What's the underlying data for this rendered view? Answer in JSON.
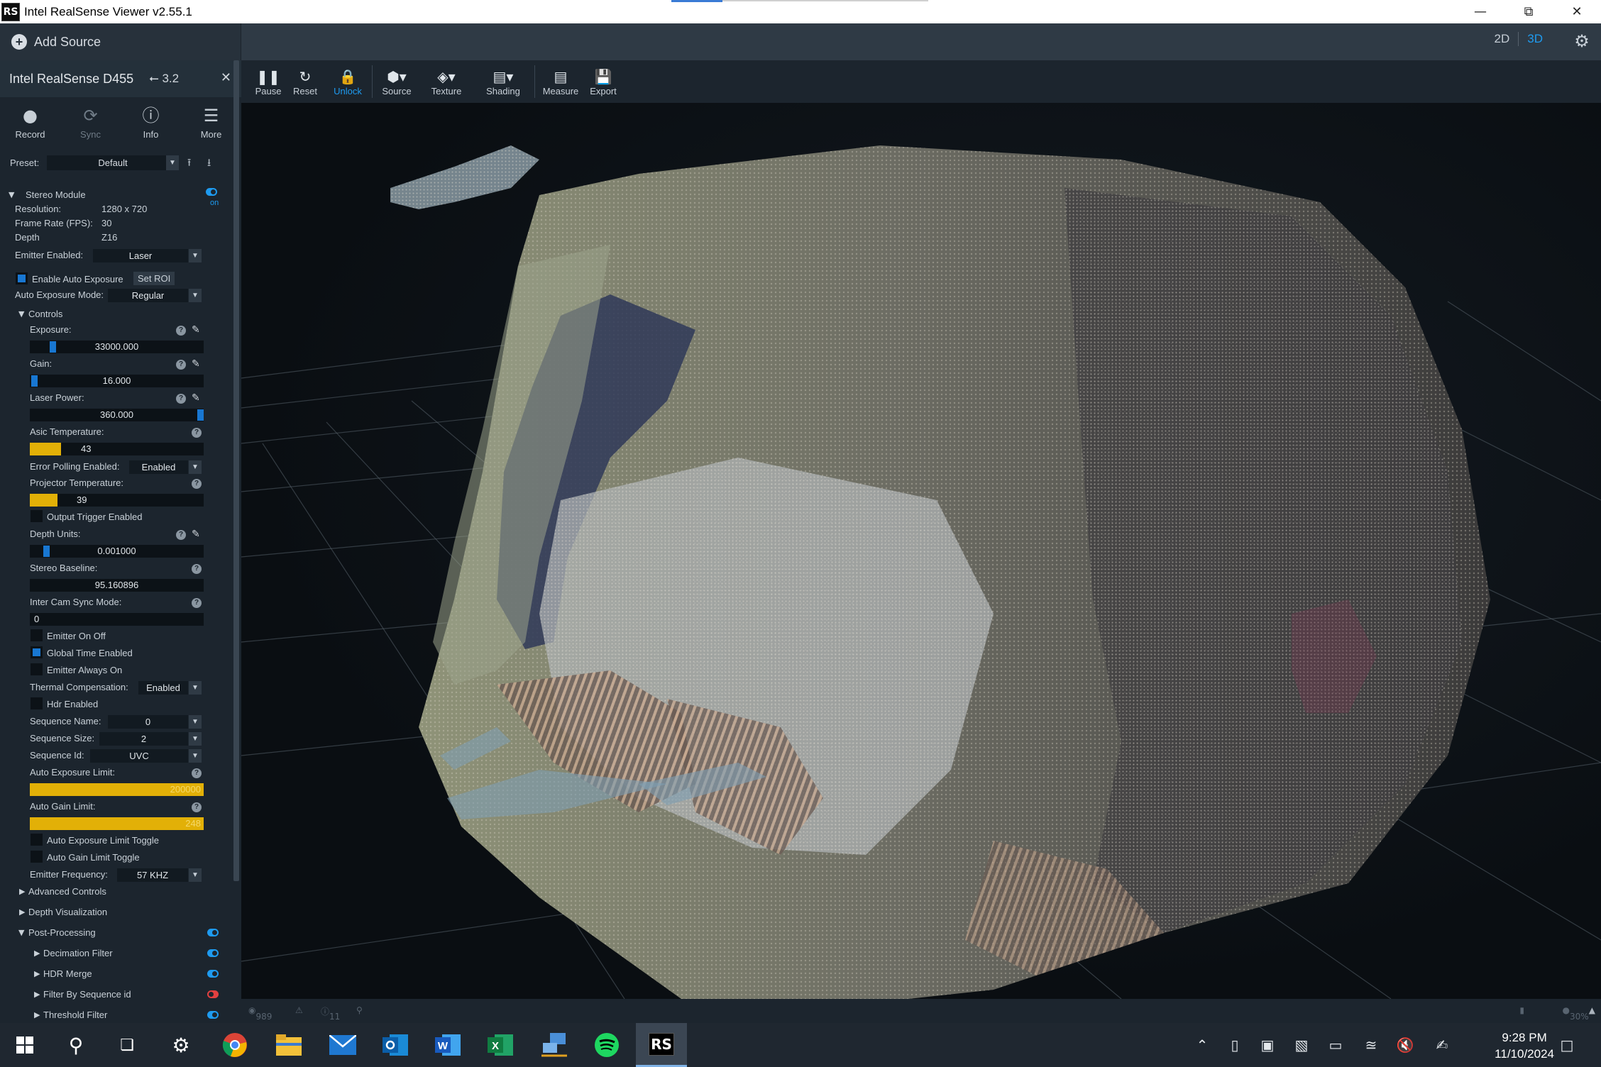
{
  "window": {
    "title": "Intel RealSense Viewer v2.55.1",
    "app_icon": "RS"
  },
  "topbar": {
    "add_source": "Add Source",
    "view_2d": "2D",
    "view_3d": "3D"
  },
  "device": {
    "name": "Intel RealSense D455",
    "usb": "3.2",
    "tools": [
      {
        "label": "Record",
        "icon": "record-icon"
      },
      {
        "label": "Sync",
        "icon": "sync-icon"
      },
      {
        "label": "Info",
        "icon": "info-icon"
      },
      {
        "label": "More",
        "icon": "menu-icon"
      }
    ],
    "preset_label": "Preset:",
    "preset_value": "Default"
  },
  "stereo": {
    "title": "Stereo Module",
    "on_label": "on",
    "resolution_label": "Resolution:",
    "resolution": "1280 x 720",
    "fps_label": "Frame Rate (FPS):",
    "fps": "30",
    "format_label": "Depth",
    "format": "Z16",
    "emitter_label": "Emitter Enabled:",
    "emitter": "Laser",
    "auto_exposure_label": "Enable Auto Exposure",
    "set_roi": "Set ROI",
    "ae_mode_label": "Auto Exposure Mode:",
    "ae_mode": "Regular",
    "controls_label": "Controls",
    "exposure_label": "Exposure:",
    "exposure": "33000.000",
    "gain_label": "Gain:",
    "gain": "16.000",
    "laser_label": "Laser Power:",
    "laser": "360.000",
    "asic_label": "Asic Temperature:",
    "asic": "43",
    "error_polling_label": "Error Polling Enabled:",
    "error_polling": "Enabled",
    "proj_temp_label": "Projector Temperature:",
    "proj_temp": "39",
    "output_trigger_label": "Output Trigger Enabled",
    "depth_units_label": "Depth Units:",
    "depth_units": "0.001000",
    "baseline_label": "Stereo Baseline:",
    "baseline": "95.160896",
    "intercam_label": "Inter Cam Sync Mode:",
    "intercam": "0",
    "emitter_onoff_label": "Emitter On Off",
    "global_time_label": "Global Time Enabled",
    "emitter_always_label": "Emitter Always On",
    "thermal_label": "Thermal Compensation:",
    "thermal": "Enabled",
    "hdr_label": "Hdr Enabled",
    "seq_name_label": "Sequence Name:",
    "seq_name": "0",
    "seq_size_label": "Sequence Size:",
    "seq_size": "2",
    "seq_id_label": "Sequence Id:",
    "seq_id": "UVC",
    "ae_limit_label": "Auto Exposure Limit:",
    "ae_limit": "200000",
    "ag_limit_label": "Auto Gain Limit:",
    "ag_limit": "248",
    "ae_limit_toggle_label": "Auto Exposure Limit Toggle",
    "ag_limit_toggle_label": "Auto Gain Limit Toggle",
    "emitter_freq_label": "Emitter Frequency:",
    "emitter_freq": "57 KHZ",
    "advanced_label": "Advanced Controls",
    "depth_vis_label": "Depth Visualization",
    "post_label": "Post-Processing",
    "decimation_label": "Decimation Filter",
    "hdr_merge_label": "HDR Merge",
    "filter_seq_label": "Filter By Sequence id",
    "threshold_label": "Threshold Filter"
  },
  "levels": {
    "exposure_knob": 0.12,
    "gain_knob": 0.01,
    "laser_knob": 1.0,
    "depth_units_knob": 0.08,
    "asic_fill": 0.18,
    "proj_temp_fill": 0.16
  },
  "toolbar": {
    "pause": "Pause",
    "reset": "Reset",
    "unlock": "Unlock",
    "source": "Source",
    "texture": "Texture",
    "shading": "Shading",
    "measure": "Measure",
    "export": "Export"
  },
  "statusbar": {
    "count": "989",
    "info_count": "11",
    "zoom": "30%"
  },
  "taskbar": {
    "time": "9:28 PM",
    "date": "11/10/2024"
  },
  "colors": {
    "accent": "#1e9bf0",
    "slider_knob": "#1877d2",
    "warn_fill": "#e2b007",
    "panel": "#1c252e"
  }
}
